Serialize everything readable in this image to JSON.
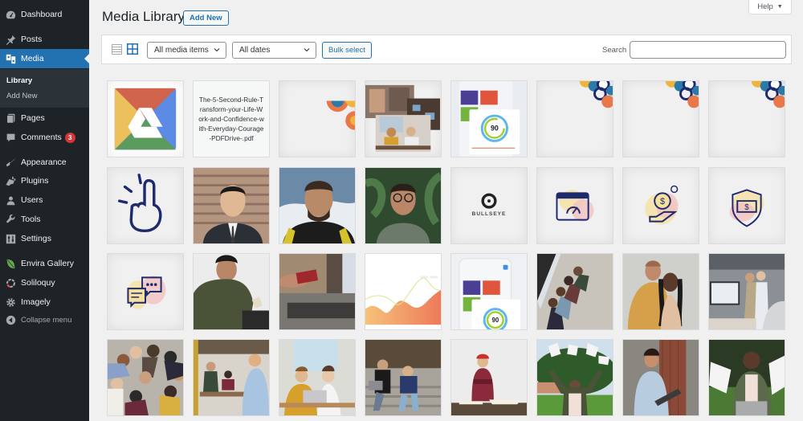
{
  "sidebar": {
    "items": [
      {
        "label": "Dashboard",
        "icon": "dashboard-icon"
      },
      {
        "label": "Posts",
        "icon": "pin-icon"
      },
      {
        "label": "Media",
        "icon": "media-icon",
        "active": true
      },
      {
        "label": "Pages",
        "icon": "pages-icon"
      },
      {
        "label": "Comments",
        "icon": "comment-icon",
        "badge": "3"
      },
      {
        "label": "Appearance",
        "icon": "paintbrush-icon"
      },
      {
        "label": "Plugins",
        "icon": "plug-icon"
      },
      {
        "label": "Users",
        "icon": "user-icon"
      },
      {
        "label": "Tools",
        "icon": "wrench-icon"
      },
      {
        "label": "Settings",
        "icon": "settings-icon"
      },
      {
        "label": "Envira Gallery",
        "icon": "leaf-icon"
      },
      {
        "label": "Soliloquy",
        "icon": "ring-icon"
      },
      {
        "label": "Imagely",
        "icon": "gear-icon"
      },
      {
        "label": "Collapse menu",
        "icon": "collapse-icon"
      }
    ],
    "submenu": [
      {
        "label": "Library",
        "current": true
      },
      {
        "label": "Add New",
        "current": false
      }
    ]
  },
  "header": {
    "title": "Media Library",
    "add_new_label": "Add New",
    "help_label": "Help",
    "help_arrow": "▼"
  },
  "toolbar": {
    "view_modes": [
      "list",
      "grid"
    ],
    "active_view": "grid",
    "media_filter": "All media items",
    "date_filter": "All dates",
    "bulk_select_label": "Bulk select",
    "search_label": "Search",
    "search_value": ""
  },
  "colors": {
    "accent": "#2271b1",
    "sidebar_bg": "#1d2327",
    "badge": "#d63638"
  },
  "media": [
    {
      "type": "image",
      "desc": "Google Drive logo"
    },
    {
      "type": "document",
      "filename": "The-5-Second-Rule-Transform-your-Life-Work-and-Confidence-with-Everyday-Courage-PDFDrive-.pdf"
    },
    {
      "type": "image",
      "desc": "colorful circle pattern partial"
    },
    {
      "type": "image",
      "desc": "photo collage of people working"
    },
    {
      "type": "image",
      "desc": "app dashboard with 90% gauge",
      "gauge_value": "90"
    },
    {
      "type": "image",
      "desc": "colorful circle pattern corner"
    },
    {
      "type": "image",
      "desc": "colorful circle pattern corner"
    },
    {
      "type": "image",
      "desc": "colorful circle pattern corner"
    },
    {
      "type": "image",
      "desc": "hand pointing up icon"
    },
    {
      "type": "image",
      "desc": "man in suit portrait"
    },
    {
      "type": "image",
      "desc": "bearded man in wetsuit"
    },
    {
      "type": "image",
      "desc": "man with glasses portrait"
    },
    {
      "type": "image",
      "desc": "Bullseye logo",
      "label": "BULLSEYE"
    },
    {
      "type": "image",
      "desc": "browser speedometer icon"
    },
    {
      "type": "image",
      "desc": "hand holding dollar coin icon"
    },
    {
      "type": "image",
      "desc": "shield with money icon"
    },
    {
      "type": "image",
      "desc": "chat bubbles icon"
    },
    {
      "type": "image",
      "desc": "man with card and laptop"
    },
    {
      "type": "image",
      "desc": "hand holding credit card at laptop"
    },
    {
      "type": "image",
      "desc": "orange area chart"
    },
    {
      "type": "image",
      "desc": "mobile app dashboard with 90% gauge",
      "gauge_value": "90"
    },
    {
      "type": "image",
      "desc": "people using phones by window"
    },
    {
      "type": "image",
      "desc": "smiling couple"
    },
    {
      "type": "image",
      "desc": "team at computer in office"
    },
    {
      "type": "image",
      "desc": "team hands together"
    },
    {
      "type": "image",
      "desc": "office meeting"
    },
    {
      "type": "image",
      "desc": "two students at laptop"
    },
    {
      "type": "image",
      "desc": "people on steps"
    },
    {
      "type": "image",
      "desc": "man in red hat at desk"
    },
    {
      "type": "image",
      "desc": "man throwing papers in park"
    },
    {
      "type": "image",
      "desc": "man with laptop by brick wall"
    },
    {
      "type": "image",
      "desc": "excited man with papers"
    }
  ]
}
